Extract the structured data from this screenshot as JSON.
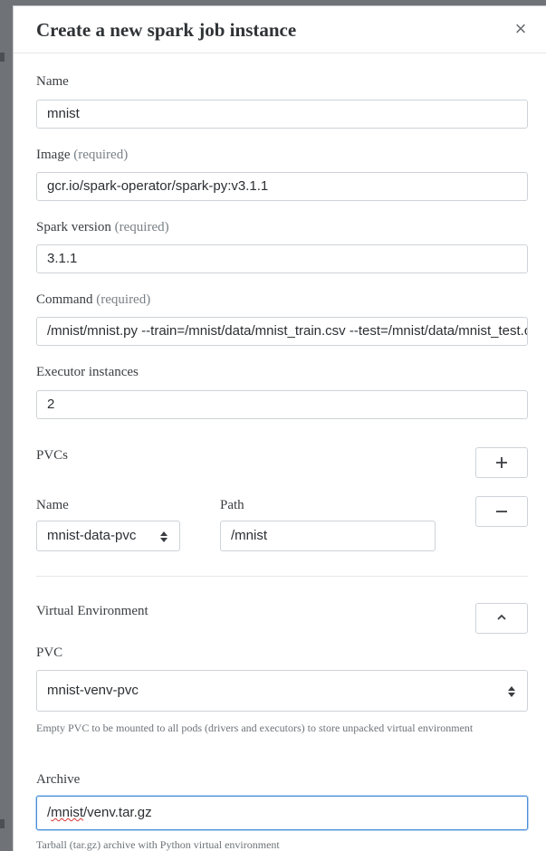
{
  "modal": {
    "title": "Create a new spark job instance",
    "close_symbol": "×"
  },
  "fields": {
    "name": {
      "label": "Name",
      "value": "mnist"
    },
    "image": {
      "label": "Image",
      "required": "(required)",
      "value": "gcr.io/spark-operator/spark-py:v3.1.1"
    },
    "spark_version": {
      "label": "Spark version",
      "required": "(required)",
      "value": "3.1.1"
    },
    "command": {
      "label": "Command",
      "required": "(required)",
      "value": "/mnist/mnist.py --train=/mnist/data/mnist_train.csv --test=/mnist/data/mnist_test.csv"
    },
    "executor_instances": {
      "label": "Executor instances",
      "value": "2"
    }
  },
  "pvcs": {
    "label": "PVCs",
    "name_label": "Name",
    "path_label": "Path",
    "name_value": "mnist-data-pvc",
    "path_value": "/mnist"
  },
  "venv": {
    "label": "Virtual Environment",
    "pvc_label": "PVC",
    "pvc_value": "mnist-venv-pvc",
    "pvc_help": "Empty PVC to be mounted to all pods (drivers and executors) to store unpacked virtual environment",
    "archive_label": "Archive",
    "archive_value_part1": "mnist",
    "archive_value_part2": "/venv.tar.gz",
    "archive_help": "Tarball (tar.gz) archive with Python virtual environment"
  },
  "icons": {
    "close": "close-icon",
    "add": "plus-icon",
    "remove": "minus-icon",
    "collapse": "chevron-up-icon",
    "select": "sort-caret-icon"
  },
  "colors": {
    "focus_border": "#4a90d9",
    "required_text": "#7a8187",
    "spellcheck": "#d33"
  }
}
